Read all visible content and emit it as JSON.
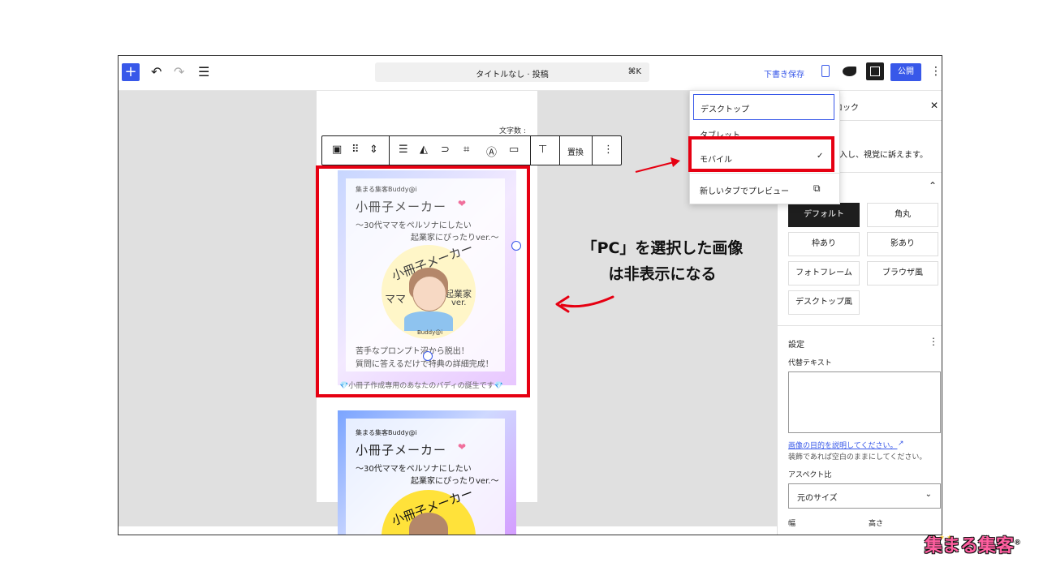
{
  "topbar": {
    "document_title": "タイトルなし · 投稿",
    "shortcut": "⌘K",
    "save_draft": "下書き保存",
    "publish": "公開"
  },
  "editor": {
    "char_count_label": "文字数 :",
    "replace_label": "置換",
    "image1": {
      "brand": "集まる集客Buddy@i",
      "title": "小冊子メーカー",
      "subtitle_line1": "〜30代ママをペルソナにしたい",
      "subtitle_line2": "起業家にぴったりver.〜",
      "circle_top": "小冊子メーカー",
      "circle_left": "ママ",
      "circle_right": "起業家",
      "circle_ver": "ver.",
      "circle_bottom": "Buddy@i",
      "footer_line1": "苦手なプロンプト沼から脱出！",
      "footer_line2": "質問に答えるだけで特典の詳細完成！"
    },
    "caption": "💎小冊子作成専用のあなたのバディの誕生です💎",
    "image2": {
      "brand": "集まる集客Buddy@i",
      "title": "小冊子メーカー",
      "subtitle_line1": "〜30代ママをペルソナにしたい",
      "subtitle_line2": "起業家にぴったりver.〜",
      "circle_top": "小冊子メーカー"
    }
  },
  "preview_menu": {
    "items": [
      "デスクトップ",
      "タブレット",
      "モバイル"
    ],
    "selected": "モバイル",
    "open_new_tab": "新しいタブでプレビュー"
  },
  "sidebar": {
    "tab_block_fragment": "ロック",
    "description_fragment": "挿入し、視覚に訴えます。",
    "styles": [
      "デフォルト",
      "角丸",
      "枠あり",
      "影あり",
      "フォトフレーム",
      "ブラウザ風",
      "デスクトップ風"
    ],
    "active_style": "デフォルト",
    "settings_label": "設定",
    "alt_text_label": "代替テキスト",
    "alt_link": "画像の目的を説明してください。",
    "alt_help": "装飾であれば空白のままにしてください。",
    "aspect_label": "アスペクト比",
    "aspect_value": "元のサイズ",
    "width_label": "幅",
    "height_label": "高さ"
  },
  "annotation": {
    "line1": "「PC」を選択した画像",
    "line2": "は非表示になる"
  },
  "logo": {
    "text": "集まる集客",
    "mark": "®"
  },
  "colors": {
    "accent": "#3858e9",
    "highlight": "#e60012"
  }
}
